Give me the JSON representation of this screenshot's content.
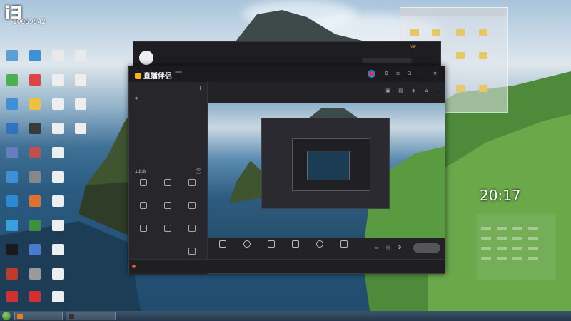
{
  "watermark": {
    "big": "i∃",
    "id": "10069542"
  },
  "desktop": {
    "icons": [
      {
        "label": "",
        "color": "#5aa0d8"
      },
      {
        "label": "",
        "color": "#3d8fd6"
      },
      {
        "label": "",
        "color": "#e9e9e9"
      },
      {
        "label": "",
        "color": "#e9e9e9"
      },
      {
        "label": "",
        "color": "#4caf50"
      },
      {
        "label": "",
        "color": "#d44"
      },
      {
        "label": "",
        "color": "#eee"
      },
      {
        "label": "",
        "color": "#eee"
      },
      {
        "label": "",
        "color": "#3d8fd6"
      },
      {
        "label": "",
        "color": "#f0c040"
      },
      {
        "label": "",
        "color": "#eee"
      },
      {
        "label": "",
        "color": "#eee"
      },
      {
        "label": "",
        "color": "#2f73c0"
      },
      {
        "label": "",
        "color": "#3a3a3a"
      },
      {
        "label": "",
        "color": "#eee"
      },
      {
        "label": "",
        "color": "#eee"
      }
    ]
  },
  "explorer": {
    "title": "",
    "folders": [
      "",
      "",
      "",
      "",
      "",
      "",
      "",
      ""
    ]
  },
  "clock": {
    "header": "",
    "time": "20:17",
    "date": ""
  },
  "back_window": {
    "title": "",
    "nav": [
      "",
      "",
      ""
    ],
    "search_placeholder": "",
    "vip": "VIP"
  },
  "main_window": {
    "app_name": "直播伴侣",
    "pill": "",
    "left_tabs": [
      "",
      "",
      ""
    ],
    "scene": "",
    "tools_title": "工具箱",
    "tools": [
      {
        "label": ""
      },
      {
        "label": ""
      },
      {
        "label": ""
      },
      {
        "label": ""
      },
      {
        "label": ""
      },
      {
        "label": ""
      },
      {
        "label": ""
      },
      {
        "label": ""
      },
      {
        "label": ""
      }
    ],
    "preview_head": "",
    "preview_tags": [
      "",
      ""
    ],
    "bottom_buttons": [
      {
        "label": ""
      },
      {
        "label": ""
      },
      {
        "label": ""
      },
      {
        "label": ""
      },
      {
        "label": ""
      },
      {
        "label": ""
      }
    ],
    "live_button": "",
    "status_msg": "",
    "status_stats": [
      "",
      "",
      "",
      ""
    ]
  },
  "taskbar": {
    "tasks": [
      {
        "label": "",
        "color": "#e67e22"
      },
      {
        "label": "",
        "color": "#333"
      }
    ],
    "tray": ""
  }
}
